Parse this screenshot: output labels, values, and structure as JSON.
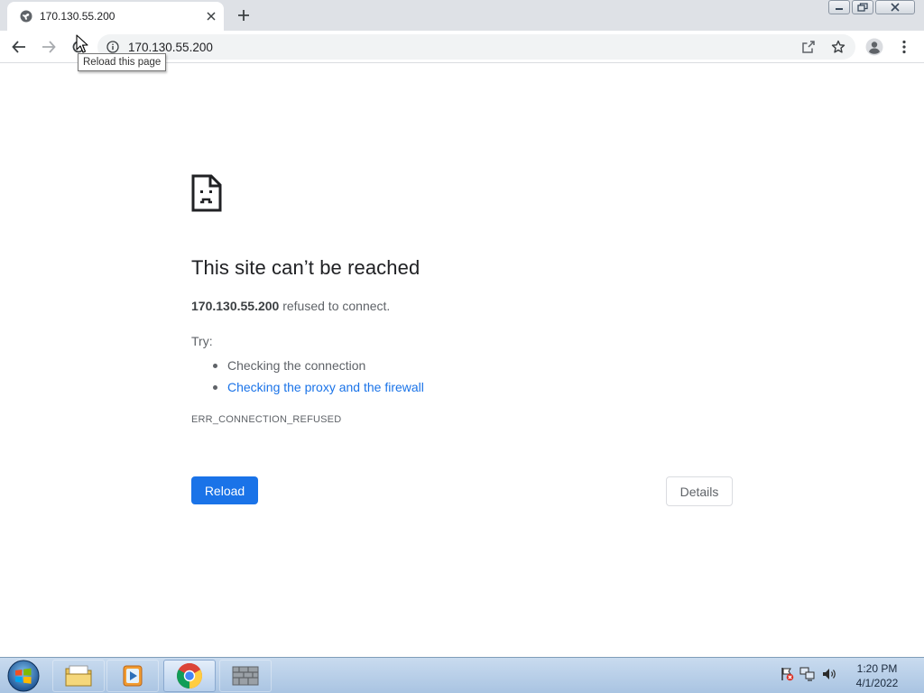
{
  "tab": {
    "title": "170.130.55.200",
    "close_icon": "close-icon",
    "favicon": "globe-icon"
  },
  "new_tab_icon": "plus-icon",
  "window_controls": {
    "minimize": "minimize-icon",
    "restore": "restore-icon",
    "close": "close-icon"
  },
  "toolbar": {
    "back_icon": "arrow-left-icon",
    "forward_icon": "arrow-right-icon",
    "reload_icon": "reload-icon",
    "tooltip": "Reload this page",
    "menu_icon": "kebab-menu-icon",
    "profile_icon": "profile-icon"
  },
  "omnibox": {
    "info_icon": "info-icon",
    "url": "170.130.55.200",
    "share_icon": "share-icon",
    "bookmark_icon": "star-icon"
  },
  "error": {
    "title": "This site can’t be reached",
    "host": "170.130.55.200",
    "message": " refused to connect.",
    "try_label": "Try:",
    "suggestions": [
      {
        "text": "Checking the connection",
        "link": false
      },
      {
        "text": "Checking the proxy and the firewall",
        "link": true
      }
    ],
    "code": "ERR_CONNECTION_REFUSED",
    "reload_label": "Reload",
    "details_label": "Details"
  },
  "taskbar": {
    "apps": [
      "file-explorer-icon",
      "media-player-icon",
      "chrome-icon",
      "firewall-app-icon"
    ],
    "active_app": "chrome-icon",
    "tray_icons": [
      "action-center-flag-icon",
      "network-icon",
      "volume-icon"
    ],
    "time": "1:20 PM",
    "date": "4/1/2022"
  },
  "colors": {
    "accent": "#1a73e8",
    "link": "#1a73e8",
    "tab_strip": "#dee1e6"
  }
}
